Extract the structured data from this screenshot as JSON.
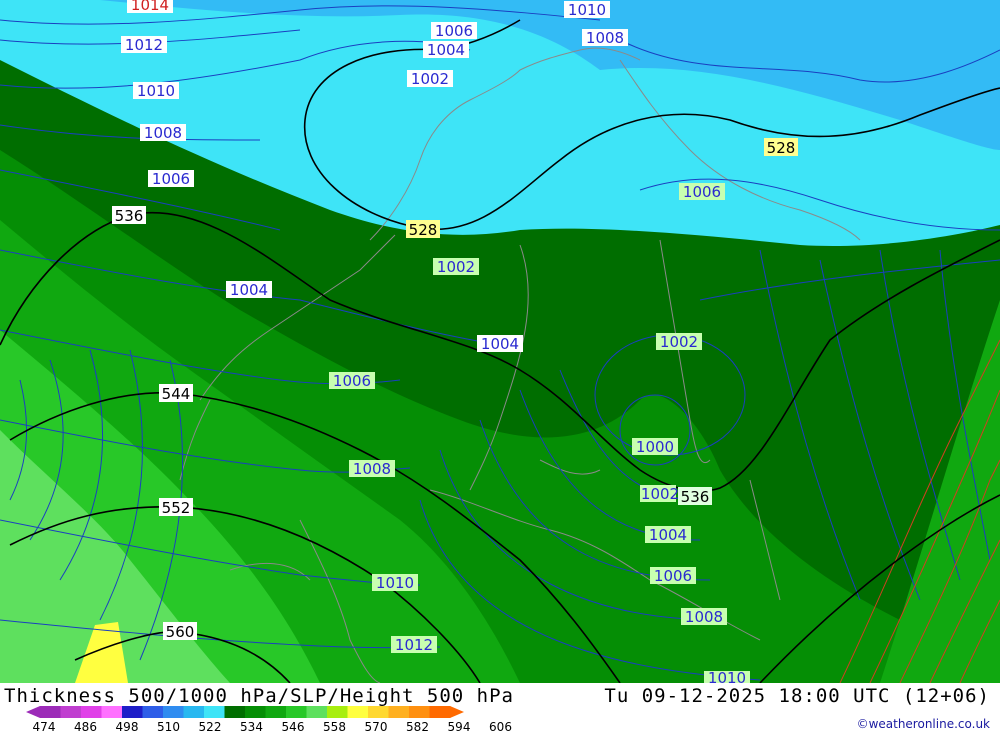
{
  "title": {
    "left": "Thickness 500/1000 hPa/SLP/Height 500 hPa",
    "right": "Tu 09-12-2025 18:00 UTC (12+06)"
  },
  "credit": "©weatheronline.co.uk",
  "colorbar": {
    "ticks": [
      "474",
      "486",
      "498",
      "510",
      "522",
      "534",
      "546",
      "558",
      "570",
      "582",
      "594",
      "606"
    ],
    "colors": [
      "#9c2bb8",
      "#c03fd0",
      "#e040e8",
      "#ff70ff",
      "#1e1ec8",
      "#2e5ee8",
      "#2f8cf0",
      "#28b8f0",
      "#3ee4f7",
      "#006e00",
      "#058e05",
      "#10a810",
      "#28c828",
      "#5ee05e",
      "#a8ee10",
      "#ffff40",
      "#ffd830",
      "#ffb020",
      "#ff9010",
      "#ff6a00"
    ]
  },
  "thickness_labels": [
    "528",
    "528",
    "536",
    "536",
    "544",
    "552",
    "560"
  ],
  "slp_labels": [
    "1014",
    "1012",
    "1010",
    "1008",
    "1006",
    "1004",
    "1002",
    "1006",
    "1004",
    "1002",
    "1010",
    "1008",
    "1006",
    "1004",
    "1002",
    "1004",
    "1006",
    "1008",
    "1010",
    "1012",
    "1002",
    "1000",
    "1002",
    "1004",
    "1006",
    "1008",
    "1010"
  ],
  "colors": {
    "deep_blue_zone": "#33bbf5",
    "light_cyan_zone": "#3ee4f7",
    "dark_green_zone": "#006e00",
    "mid_green_zone": "#058e05",
    "green_zone": "#10a810",
    "light_green_zone": "#28c828",
    "lime_zone": "#5ee05e",
    "yellow_zone": "#ffff40",
    "thickness_line": "#000000",
    "slp_line": "#1a3fc0",
    "coast": "#8a8a8a"
  }
}
